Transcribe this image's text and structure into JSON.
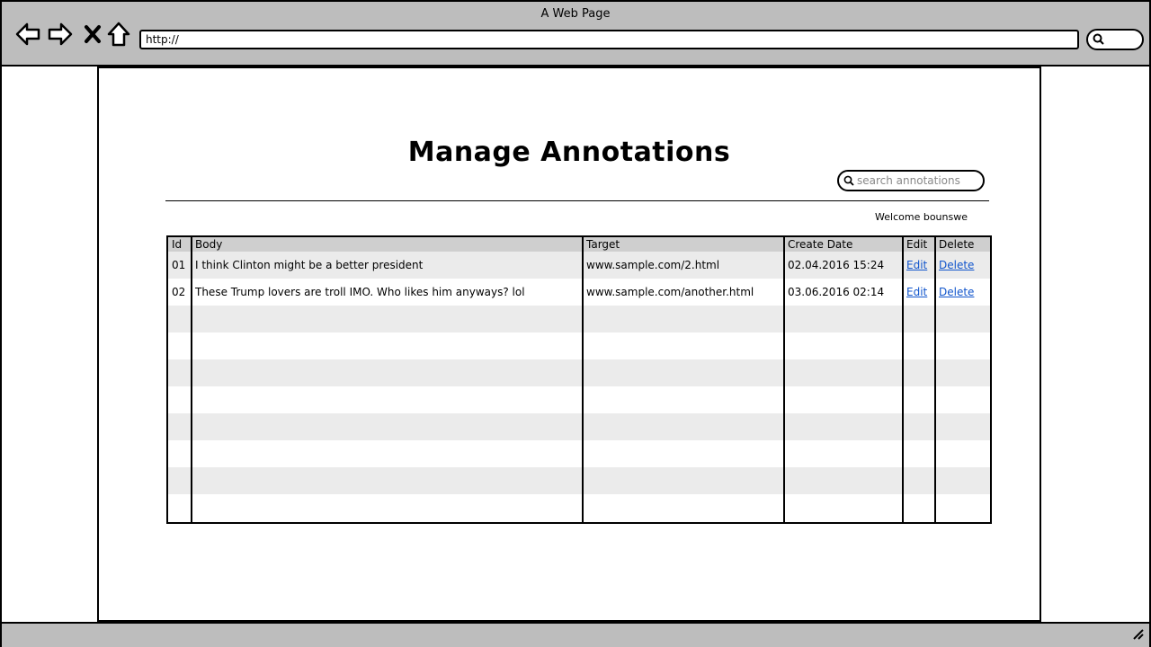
{
  "browser": {
    "window_title": "A Web Page",
    "url": "http://"
  },
  "page": {
    "title": "Manage Annotations",
    "search_placeholder": "search annotations",
    "welcome": "Welcome bounswe"
  },
  "table": {
    "headers": [
      "Id",
      "Body",
      "Target",
      "Create Date",
      "Edit",
      "Delete"
    ],
    "rows": [
      {
        "id": "01",
        "body": "I think Clinton might be a better president",
        "target": "www.sample.com/2.html",
        "date": "02.04.2016 15:24",
        "edit": "Edit",
        "delete": "Delete"
      },
      {
        "id": "02",
        "body": "These Trump lovers are troll IMO. Who likes him anyways? lol",
        "target": "www.sample.com/another.html",
        "date": "03.06.2016 02:14",
        "edit": "Edit",
        "delete": "Delete"
      }
    ]
  }
}
